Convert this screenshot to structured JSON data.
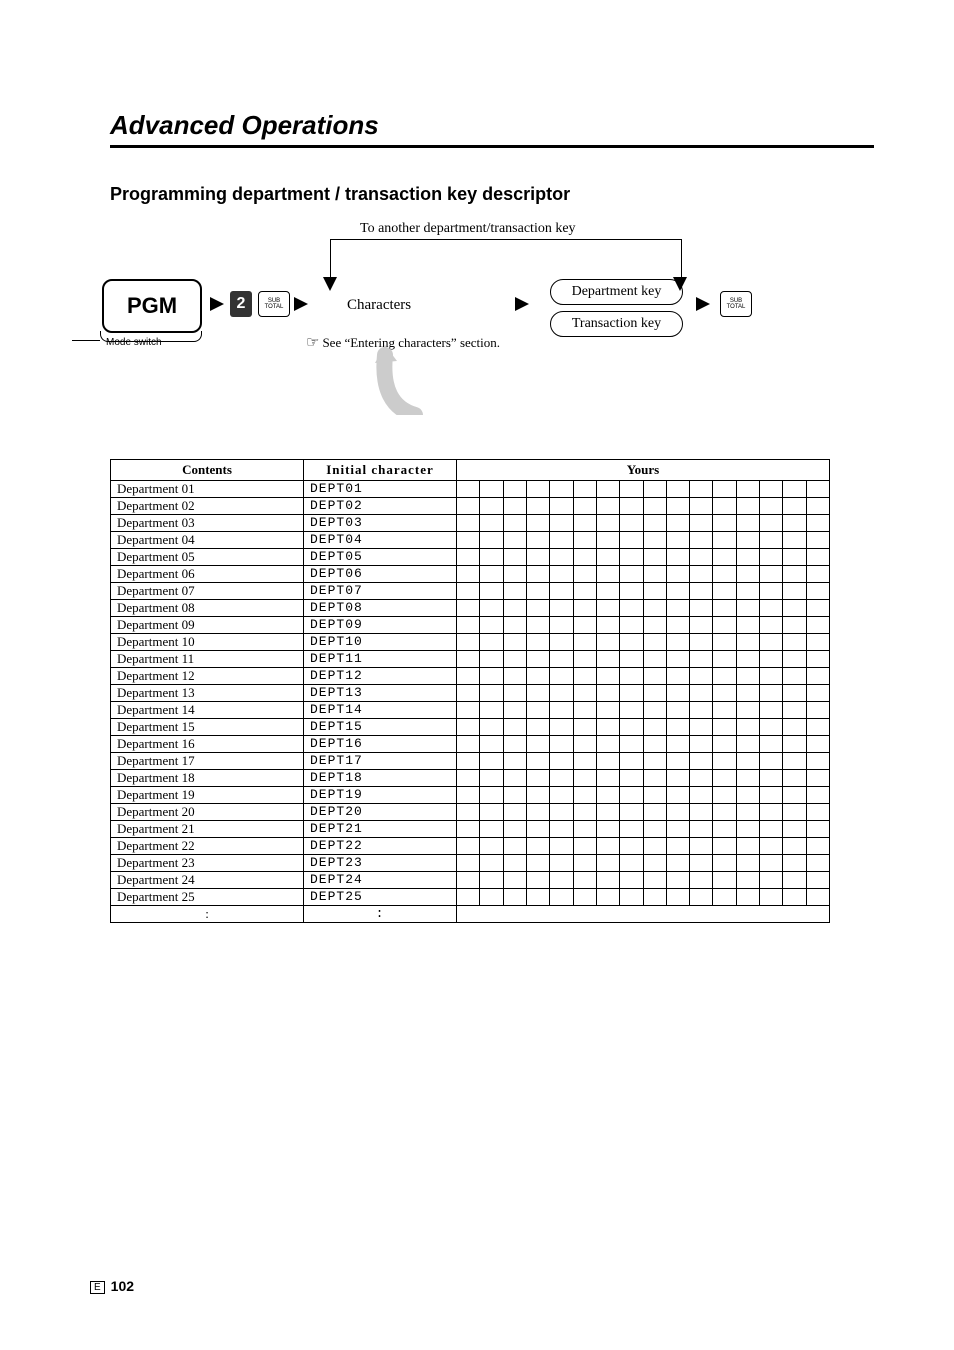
{
  "title": "Advanced Operations",
  "section_title": "Programming department / transaction key descriptor",
  "diagram": {
    "top_caption": "To another department/transaction key",
    "pgm": "PGM",
    "mode_switch": "Mode switch",
    "key2": "2",
    "sub_total_top": "SUB",
    "sub_total_bottom": "TOTAL",
    "characters": "Characters",
    "see_note": "See “Entering characters” section.",
    "pointer": "☞",
    "department_key": "Department key",
    "transaction_key": "Transaction key"
  },
  "table": {
    "headers": {
      "contents": "Contents",
      "initial": "Initial character",
      "yours": "Yours"
    },
    "yours_cols": 16,
    "rows": [
      {
        "c": "Department 01",
        "i": "DEPT01"
      },
      {
        "c": "Department 02",
        "i": "DEPT02"
      },
      {
        "c": "Department 03",
        "i": "DEPT03"
      },
      {
        "c": "Department 04",
        "i": "DEPT04"
      },
      {
        "c": "Department 05",
        "i": "DEPT05"
      },
      {
        "c": "Department 06",
        "i": "DEPT06"
      },
      {
        "c": "Department 07",
        "i": "DEPT07"
      },
      {
        "c": "Department 08",
        "i": "DEPT08"
      },
      {
        "c": "Department 09",
        "i": "DEPT09"
      },
      {
        "c": "Department 10",
        "i": "DEPT10"
      },
      {
        "c": "Department 11",
        "i": "DEPT11"
      },
      {
        "c": "Department 12",
        "i": "DEPT12"
      },
      {
        "c": "Department 13",
        "i": "DEPT13"
      },
      {
        "c": "Department 14",
        "i": "DEPT14"
      },
      {
        "c": "Department 15",
        "i": "DEPT15"
      },
      {
        "c": "Department 16",
        "i": "DEPT16"
      },
      {
        "c": "Department 17",
        "i": "DEPT17"
      },
      {
        "c": "Department 18",
        "i": "DEPT18"
      },
      {
        "c": "Department 19",
        "i": "DEPT19"
      },
      {
        "c": "Department 20",
        "i": "DEPT20"
      },
      {
        "c": "Department 21",
        "i": "DEPT21"
      },
      {
        "c": "Department 22",
        "i": "DEPT22"
      },
      {
        "c": "Department 23",
        "i": "DEPT23"
      },
      {
        "c": "Department 24",
        "i": "DEPT24"
      },
      {
        "c": "Department 25",
        "i": "DEPT25"
      }
    ],
    "ellipsis": ":"
  },
  "page_marker": "E",
  "page_number": "102"
}
